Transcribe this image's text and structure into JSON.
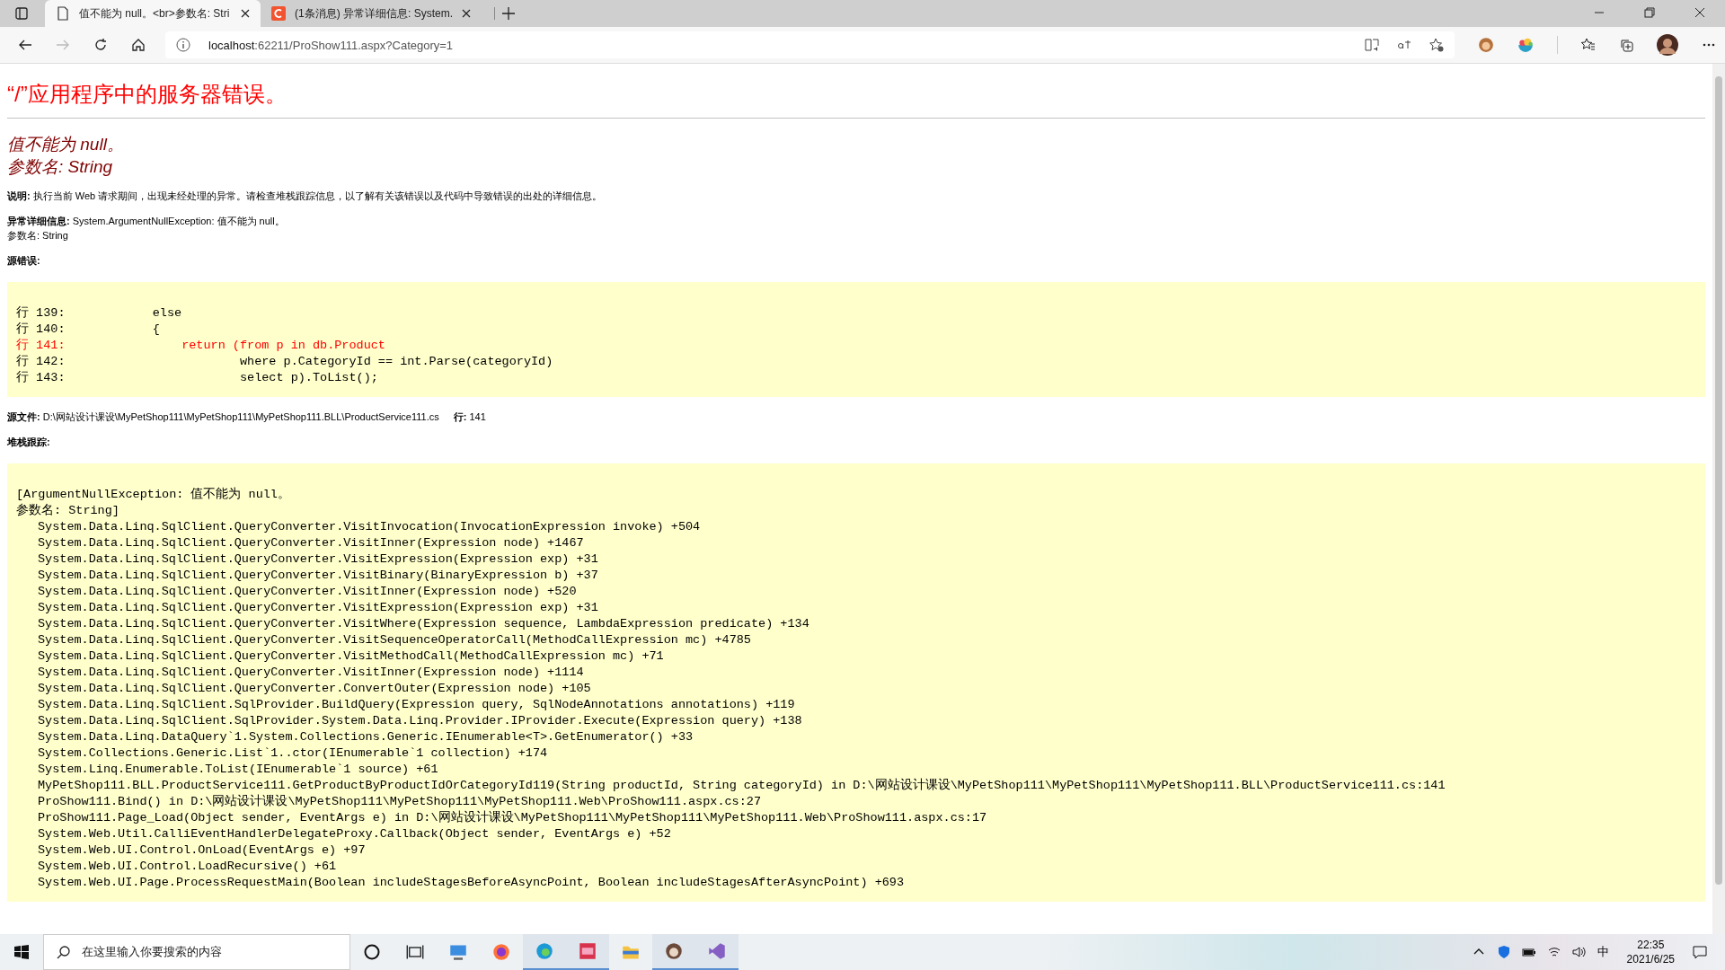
{
  "browser": {
    "tabs": [
      {
        "title": "值不能为 null。<br>参数名: Stri",
        "selected": true,
        "kind": "page"
      },
      {
        "title": "(1条消息) 异常详细信息: System.",
        "selected": false,
        "kind": "site"
      }
    ],
    "address_bar": {
      "host": "localhost",
      "path": ":62211/ProShow111.aspx?Category=1"
    }
  },
  "page": {
    "title": "“/”应用程序中的服务器错误。",
    "error_lines": [
      "值不能为 null。",
      "参数名: String"
    ],
    "description": {
      "label": "说明:",
      "text": "执行当前 Web 请求期间，出现未经处理的异常。请检查堆栈跟踪信息，以了解有关该错误以及代码中导致错误的出处的详细信息。"
    },
    "exception": {
      "label": "异常详细信息:",
      "text": "System.ArgumentNullException: 值不能为 null。",
      "extra": "参数名: String"
    },
    "source_error": {
      "label": "源错误:"
    },
    "source_lines": [
      {
        "text": "行 139:            else",
        "highlighted": false
      },
      {
        "text": "行 140:            {",
        "highlighted": false
      },
      {
        "text": "行 141:                return (from p in db.Product",
        "highlighted": true
      },
      {
        "text": "行 142:                        where p.CategoryId == int.Parse(categoryId)",
        "highlighted": false
      },
      {
        "text": "行 143:                        select p).ToList();",
        "highlighted": false
      }
    ],
    "source_file": {
      "label": "源文件:",
      "path": "D:\\网站设计课设\\MyPetShop111\\MyPetShop111\\MyPetShop111.BLL\\ProductService111.cs",
      "line_label": "行:",
      "line": "141"
    },
    "stack_trace": {
      "label": "堆栈跟踪:",
      "header": [
        "[ArgumentNullException: 值不能为 null。",
        "参数名: String]"
      ],
      "frames": [
        "System.Data.Linq.SqlClient.QueryConverter.VisitInvocation(InvocationExpression invoke) +504",
        "System.Data.Linq.SqlClient.QueryConverter.VisitInner(Expression node) +1467",
        "System.Data.Linq.SqlClient.QueryConverter.VisitExpression(Expression exp) +31",
        "System.Data.Linq.SqlClient.QueryConverter.VisitBinary(BinaryExpression b) +37",
        "System.Data.Linq.SqlClient.QueryConverter.VisitInner(Expression node) +520",
        "System.Data.Linq.SqlClient.QueryConverter.VisitExpression(Expression exp) +31",
        "System.Data.Linq.SqlClient.QueryConverter.VisitWhere(Expression sequence, LambdaExpression predicate) +134",
        "System.Data.Linq.SqlClient.QueryConverter.VisitSequenceOperatorCall(MethodCallExpression mc) +4785",
        "System.Data.Linq.SqlClient.QueryConverter.VisitMethodCall(MethodCallExpression mc) +71",
        "System.Data.Linq.SqlClient.QueryConverter.VisitInner(Expression node) +1114",
        "System.Data.Linq.SqlClient.QueryConverter.ConvertOuter(Expression node) +105",
        "System.Data.Linq.SqlClient.SqlProvider.BuildQuery(Expression query, SqlNodeAnnotations annotations) +119",
        "System.Data.Linq.SqlClient.SqlProvider.System.Data.Linq.Provider.IProvider.Execute(Expression query) +138",
        "System.Data.Linq.DataQuery`1.System.Collections.Generic.IEnumerable<T>.GetEnumerator() +33",
        "System.Collections.Generic.List`1..ctor(IEnumerable`1 collection) +174",
        "System.Linq.Enumerable.ToList(IEnumerable`1 source) +61",
        "MyPetShop111.BLL.ProductService111.GetProductByProductIdOrCategoryId119(String productId, String categoryId) in D:\\网站设计课设\\MyPetShop111\\MyPetShop111\\MyPetShop111.BLL\\ProductService111.cs:141",
        "ProShow111.Bind() in D:\\网站设计课设\\MyPetShop111\\MyPetShop111\\MyPetShop111.Web\\ProShow111.aspx.cs:27",
        "ProShow111.Page_Load(Object sender, EventArgs e) in D:\\网站设计课设\\MyPetShop111\\MyPetShop111\\MyPetShop111.Web\\ProShow111.aspx.cs:17",
        "System.Web.Util.CalliEventHandlerDelegateProxy.Callback(Object sender, EventArgs e) +52",
        "System.Web.UI.Control.OnLoad(EventArgs e) +97",
        "System.Web.UI.Control.LoadRecursive() +61",
        "System.Web.UI.Page.ProcessRequestMain(Boolean includeStagesBeforeAsyncPoint, Boolean includeStagesAfterAsyncPoint) +693"
      ]
    }
  },
  "taskbar": {
    "search_placeholder": "在这里输入你要搜索的内容",
    "ime": "中",
    "time": "22:35",
    "date": "2021/6/25"
  }
}
